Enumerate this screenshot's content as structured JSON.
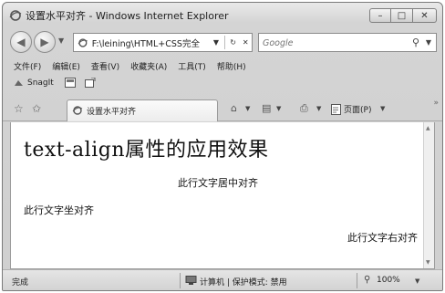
{
  "window": {
    "title": "设置水平对齐 - Windows Internet Explorer",
    "minimize": "–",
    "maximize": "□",
    "close": "✕"
  },
  "address": {
    "back": "◀",
    "forward": "▶",
    "history_dropdown": "▼",
    "url": "F:\\leining\\HTML+CSS完全",
    "dropdown": "▼",
    "refresh": "↻",
    "stop": "✕"
  },
  "search": {
    "placeholder": "Google",
    "button": "⚲",
    "dropdown": "▼"
  },
  "menu": {
    "items": [
      "文件(F)",
      "编辑(E)",
      "查看(V)",
      "收藏夹(A)",
      "工具(T)",
      "帮助(H)"
    ]
  },
  "linkbar": {
    "snagit": "SnagIt"
  },
  "tabs": {
    "favorites": "☆",
    "add_favorite": "✩",
    "active_tab": "设置水平对齐",
    "home": "⌂",
    "feeds": "▤",
    "print": "⎙",
    "page_label": "页面(P)",
    "dropdown": "▼",
    "more": "»"
  },
  "content": {
    "heading": "text-align属性的应用效果",
    "center_text": "此行文字居中对齐",
    "left_text": "此行文字坐对齐",
    "right_text": "此行文字右对齐"
  },
  "scrollbar": {
    "up": "▲",
    "down": "▼"
  },
  "status": {
    "text": "完成",
    "zone": "计算机 | 保护模式: 禁用",
    "zoom_icon": "⚲",
    "zoom": "100%",
    "zoom_dropdown": "▼"
  }
}
